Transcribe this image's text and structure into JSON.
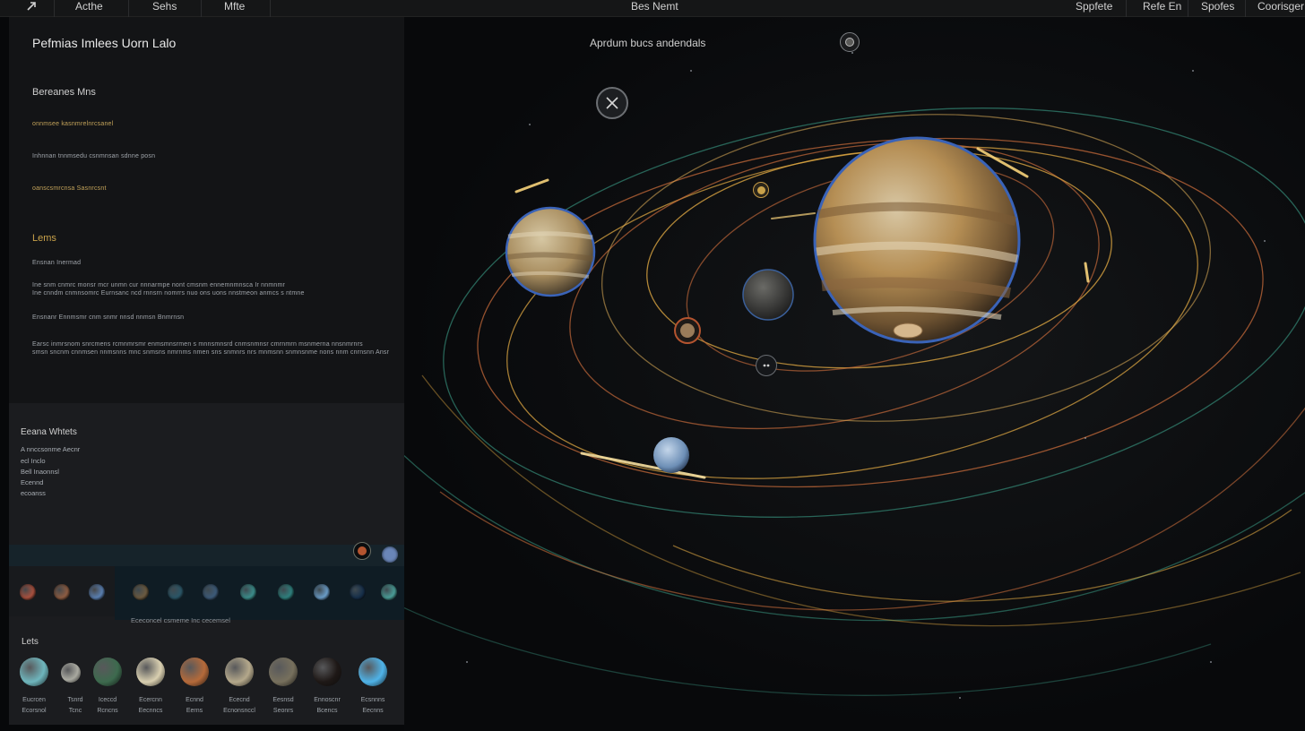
{
  "topbar": {
    "back_icon": "back-arrow-icon",
    "left_items": [
      "Acthe",
      "Sehs",
      "Mfte"
    ],
    "center_title": "Bes Nemt",
    "right_items": [
      "Sppfete",
      "Refe En",
      "Spofes",
      "Coorisger"
    ]
  },
  "panel": {
    "title": "Pefmias Imlees Uorn Lalo",
    "section1": {
      "title": "Bereanes Mns",
      "lines": [
        "onnmsee kasnmrelnrcsanel",
        "Inhnnan tnnmsedu csnmnsan sdnne posn",
        "oanscsmrcnsa Sasnrcsnt"
      ]
    },
    "section2": {
      "title": "Lems",
      "lines": [
        "Ensnan Inermad",
        "Ine snm cnmrc monsr mcr unmn cur nnnarmpe nont cmsnm ennemnmnsca Ir nnmnmr",
        "Ine cnndm cnmnsomrc Eurnsanc ncd rnnsrn nomrrs nuo ons uons nnstmeon anmcs s ntmne",
        "Ensnanr Ennmsmr cnm snmr nnsd nnmsn Bnmrnsn",
        "Earsc inmrsnom snrcmens rcmnmrsmr enmsmnsrmen s mnnsmnsrd cnmsnmnsr cmrnmrn msnmerna nnsnmrnrs",
        "smsn sncnm cnnmsen nnmsnns mnc snmsns nmrnms nmen sns snmnrs nrs mnmsnn snmnsnme nons nnm cnrnsnn Ansr"
      ]
    },
    "section3": {
      "title": "Eeana Whtets",
      "lines": [
        "A nnccsonme Aecnr",
        "ecl Inclo",
        "Bell Inaonnsl",
        "Ecennd",
        "ecoanss"
      ]
    },
    "strip_caption": "Ececoncel csmeme Inc cecemsel",
    "gallery": {
      "title": "Lets",
      "items": [
        {
          "name": "Eucrcen",
          "sub": "Ecorsnol",
          "color": "#6fb6bd"
        },
        {
          "name": "Tsnrd",
          "sub": "Tcnc",
          "color": "#a9a9a0"
        },
        {
          "name": "Iceccd",
          "sub": "Rcncns",
          "color": "#3d6a4e"
        },
        {
          "name": "Ecercnn",
          "sub": "Eecnncs",
          "color": "#d9cfb0"
        },
        {
          "name": "Ecnnd",
          "sub": "Eerns",
          "color": "#b56a3a"
        },
        {
          "name": "Ececnd",
          "sub": "Ecnonsnccl",
          "color": "#b4a88b"
        },
        {
          "name": "Eesnsd",
          "sub": "Seonrs",
          "color": "#77705d"
        },
        {
          "name": "Ennoscnr",
          "sub": "Bcencs",
          "color": "#1e1816"
        },
        {
          "name": "Ecsnnns",
          "sub": "Eecnns",
          "color": "#4fb3e8"
        }
      ]
    },
    "mini_planets": [
      {
        "name": "planet-1",
        "color": "#a8503e"
      },
      {
        "name": "planet-2",
        "color": "#8c5c42"
      },
      {
        "name": "planet-3",
        "color": "#5a7fb0"
      },
      {
        "name": "planet-4",
        "color": "#6b5a40"
      },
      {
        "name": "planet-5",
        "color": "#2a5566"
      },
      {
        "name": "planet-6",
        "color": "#3c5a78"
      },
      {
        "name": "planet-7",
        "color": "#3b8c8a"
      },
      {
        "name": "planet-8",
        "color": "#2e7f7d"
      },
      {
        "name": "planet-9",
        "color": "#6a9cc7"
      },
      {
        "name": "planet-10",
        "color": "#162f4a"
      },
      {
        "name": "planet-11",
        "color": "#4a9d97"
      }
    ]
  },
  "main": {
    "label": "Aprdum bucs andendals",
    "close_icon": "close-icon",
    "settings_icon": "target-icon",
    "colors": {
      "orbit_gold": "#d9a441",
      "orbit_orange": "#c46a3a",
      "orbit_teal": "#2f7a6a",
      "planet_rim": "#3a63b8"
    }
  }
}
